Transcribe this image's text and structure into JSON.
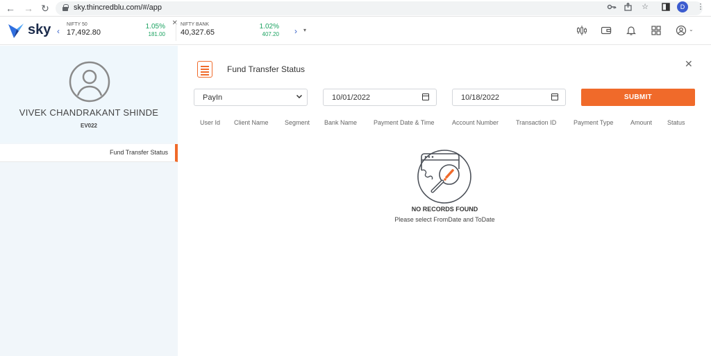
{
  "browser": {
    "url": "sky.thincredblu.com/#/app",
    "profile_initial": "D"
  },
  "header": {
    "logo_text": "sky",
    "indices": [
      {
        "name": "NIFTY 50",
        "value": "17,492.80",
        "pct": "1.05%",
        "change": "181.00"
      },
      {
        "name": "NIFTY BANK",
        "value": "40,327.65",
        "pct": "1.02%",
        "change": "407.20"
      }
    ]
  },
  "sidebar": {
    "user_name": "VIVEK CHANDRAKANT SHINDE",
    "user_id": "EV022",
    "menu": [
      {
        "label": "Fund Transfer Status"
      }
    ]
  },
  "main": {
    "title": "Fund Transfer Status",
    "filters": {
      "type": "PayIn",
      "from_date": "10/01/2022",
      "to_date": "10/18/2022",
      "submit_label": "SUBMIT"
    },
    "columns": [
      "User Id",
      "Client Name",
      "Segment",
      "Bank Name",
      "Payment Date & Time",
      "Account Number",
      "Transaction ID",
      "Payment Type",
      "Amount",
      "Status"
    ],
    "empty": {
      "title": "NO RECORDS FOUND",
      "subtitle": "Please select FromDate and ToDate"
    }
  },
  "colors": {
    "accent": "#f06a2a",
    "positive": "#1aa260",
    "brand_blue": "#3a63c9"
  }
}
